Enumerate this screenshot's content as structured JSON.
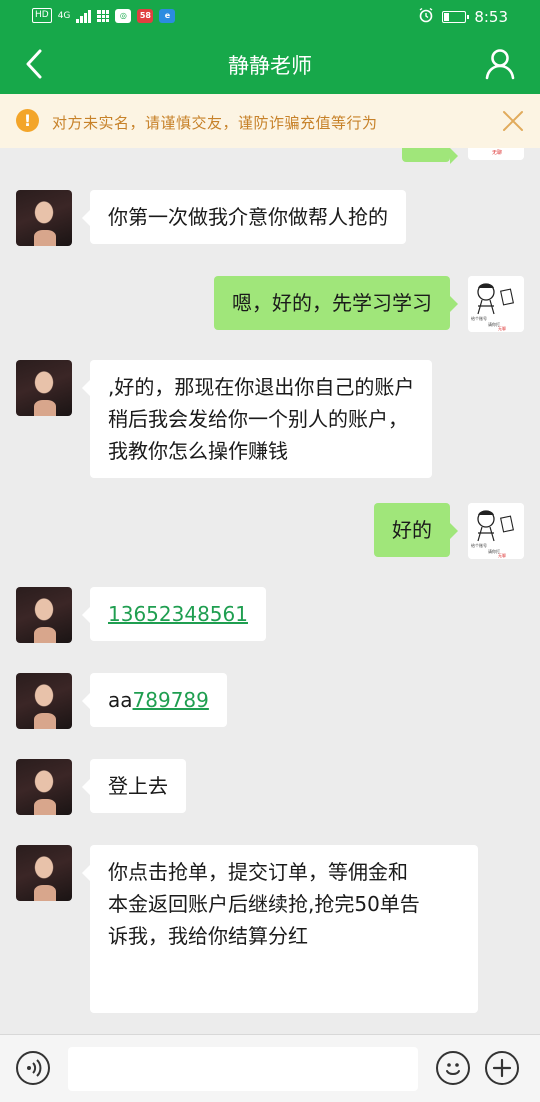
{
  "status_bar": {
    "network_badge": "HD",
    "network_type": "4G",
    "app_badge": "58",
    "time": "8:53"
  },
  "header": {
    "title": "静静老师"
  },
  "warning": {
    "text": "对方未实名，请谨慎交友，谨防诈骗充值等行为"
  },
  "messages": [
    {
      "side": "left",
      "text": "你第一次做我介意你做帮人抢的"
    },
    {
      "side": "right",
      "text": "嗯，好的，先学习学习"
    },
    {
      "side": "left",
      "lines": [
        ",好的，那现在你退出你自己的账户",
        "稍后我会发给你一个别人的账户，",
        "我教你怎么操作赚钱"
      ]
    },
    {
      "side": "right",
      "text": "好的"
    },
    {
      "side": "left",
      "link": "13652348561"
    },
    {
      "side": "left",
      "prefix": "aa",
      "link": "789789"
    },
    {
      "side": "left",
      "text": "登上去"
    },
    {
      "side": "left",
      "lines": [
        "你点击抢单，提交订单，等佣金和",
        "本金返回账户后继续抢,抢完50单告",
        "诉我，我给你结算分红"
      ]
    }
  ],
  "input": {
    "value": ""
  },
  "colors": {
    "primary": "#17a84a",
    "outgoing_bubble": "#a0e67a",
    "warning_bg": "#fcf4e3",
    "warning_text": "#c7822a",
    "link": "#1f9e50"
  },
  "icons": {
    "back": "chevron-left-icon",
    "profile": "person-icon",
    "warning": "exclamation-icon",
    "close": "close-icon",
    "voice": "voice-icon",
    "emoji": "smiley-icon",
    "plus": "plus-icon"
  }
}
